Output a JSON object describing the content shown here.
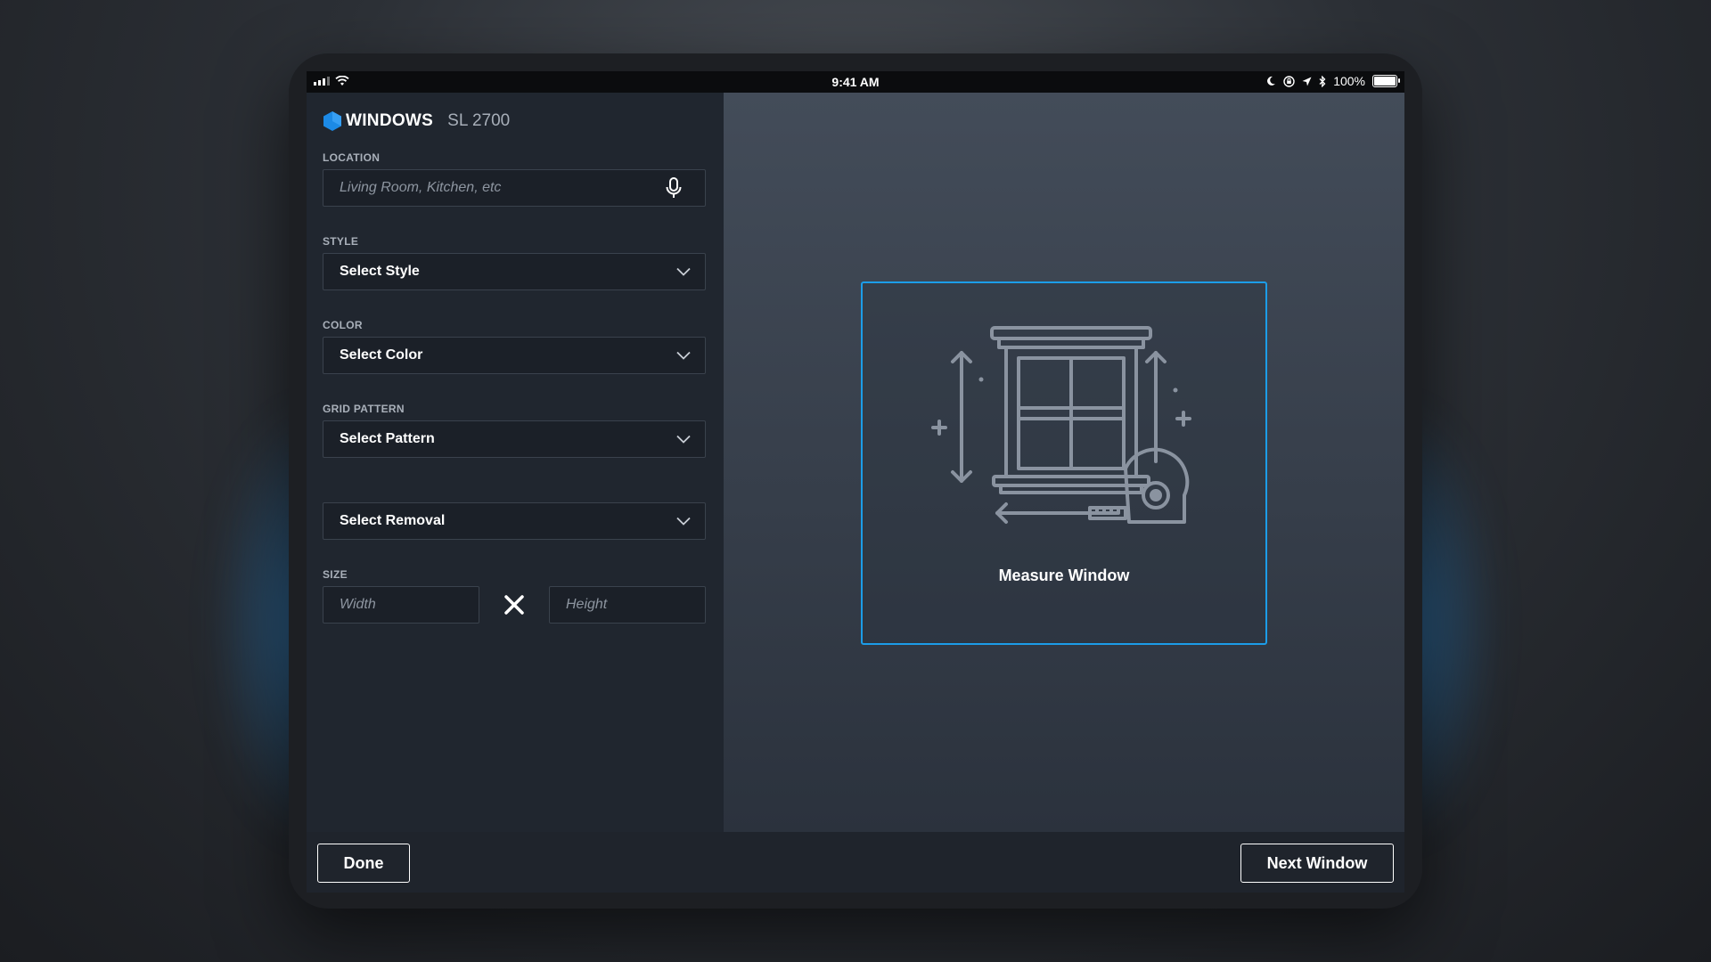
{
  "statusbar": {
    "time": "9:41 AM",
    "battery": "100%",
    "icons": [
      "cellular-signal-icon",
      "wifi-icon",
      "moon-icon",
      "orientation-lock-icon",
      "location-arrow-icon",
      "bluetooth-icon",
      "battery-icon"
    ]
  },
  "brand": {
    "name": "WINDOWS",
    "model": "SL 2700",
    "accent_color": "#1c8ae6"
  },
  "form": {
    "location": {
      "label": "LOCATION",
      "placeholder": "Living Room, Kitchen, etc",
      "icon": "microphone-icon"
    },
    "style": {
      "label": "STYLE",
      "value": "Select Style"
    },
    "color": {
      "label": "COLOR",
      "value": "Select Color"
    },
    "grid_pattern": {
      "label": "GRID PATTERN",
      "value": "Select Pattern"
    },
    "removal": {
      "value": "Select Removal"
    },
    "size": {
      "label": "SIZE",
      "width_placeholder": "Width",
      "height_placeholder": "Height",
      "separator_icon": "times-icon"
    }
  },
  "main": {
    "measure_card": {
      "label": "Measure Window",
      "icon": "window-measure-illustration",
      "border_color": "#1c9de8"
    }
  },
  "footer": {
    "done_label": "Done",
    "next_label": "Next Window"
  }
}
